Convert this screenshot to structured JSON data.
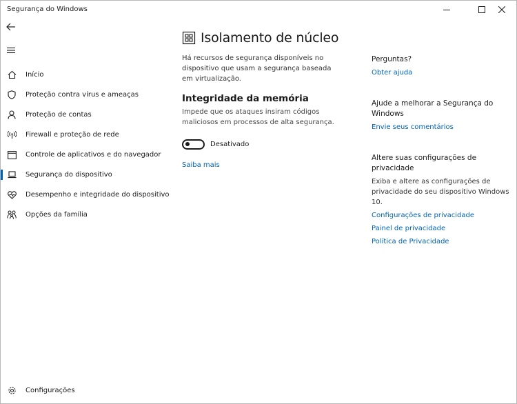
{
  "window": {
    "title": "Segurança do Windows"
  },
  "nav": {
    "items": [
      {
        "label": "Início"
      },
      {
        "label": "Proteção contra vírus e ameaças"
      },
      {
        "label": "Proteção de contas"
      },
      {
        "label": "Firewall e proteção de rede"
      },
      {
        "label": "Controle de aplicativos e do navegador"
      },
      {
        "label": "Segurança do dispositivo"
      },
      {
        "label": "Desempenho e integridade do dispositivo"
      },
      {
        "label": "Opções da família"
      }
    ],
    "active_index": 5,
    "settings_label": "Configurações"
  },
  "main": {
    "title": "Isolamento de núcleo",
    "description": "Há recursos de segurança disponíveis no dispositivo que usam a segurança baseada em virtualização.",
    "memory_integrity": {
      "title": "Integridade da memória",
      "description": "Impede que os ataques insiram códigos maliciosos em processos de alta segurança.",
      "toggle_state": "Desativado",
      "toggle_on": false
    },
    "learn_more": "Saiba mais"
  },
  "side": {
    "questions": {
      "title": "Perguntas?",
      "link": "Obter ajuda"
    },
    "improve": {
      "title": "Ajude a melhorar a Segurança do Windows",
      "link": "Envie seus comentários"
    },
    "privacy": {
      "title": "Altere suas configurações de privacidade",
      "text": "Exiba e altere as configurações de privacidade do seu dispositivo Windows 10.",
      "links": [
        "Configurações de privacidade",
        "Painel de privacidade",
        "Política de Privacidade"
      ]
    }
  },
  "colors": {
    "accent": "#0063b1",
    "text": "#1a1a1a",
    "background": "#ffffff"
  },
  "icons": {
    "back": "arrow-left-icon",
    "menu": "hamburger-icon",
    "home": "home-icon",
    "virus": "shield-icon",
    "account": "person-icon",
    "firewall": "wifi-antenna-icon",
    "app": "browser-window-icon",
    "device": "laptop-icon",
    "health": "heart-pulse-icon",
    "family": "family-icon",
    "settings": "gear-icon",
    "core": "chip-icon"
  }
}
